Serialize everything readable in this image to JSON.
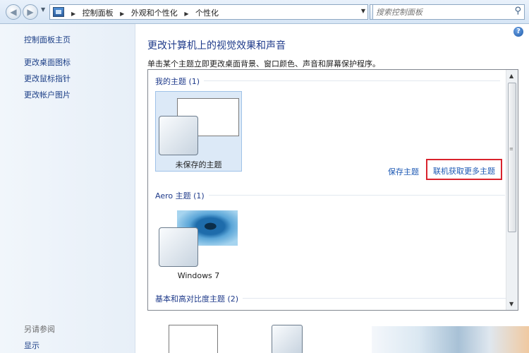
{
  "address_bar": {
    "breadcrumbs": [
      "控制面板",
      "外观和个性化",
      "个性化"
    ],
    "search_placeholder": "搜索控制面板"
  },
  "left_nav": {
    "items": [
      "控制面板主页",
      "更改桌面图标",
      "更改鼠标指针",
      "更改帐户图片"
    ],
    "see_also_label": "另请参阅",
    "see_also_items": [
      "显示"
    ]
  },
  "main": {
    "title": "更改计算机上的视觉效果和声音",
    "subtitle": "单击某个主题立即更改桌面背景、窗口颜色、声音和屏幕保护程序。",
    "groups": {
      "my_themes": "我的主题 (1)",
      "aero_themes": "Aero 主题 (1)",
      "basic_themes": "基本和高对比度主题 (2)"
    },
    "themes": {
      "unsaved": "未保存的主题",
      "windows7": "Windows 7"
    },
    "links": {
      "save_theme": "保存主题",
      "get_more_online": "联机获取更多主题"
    },
    "highlight_color": "#d9232d",
    "link_color": "#1b57b3"
  }
}
